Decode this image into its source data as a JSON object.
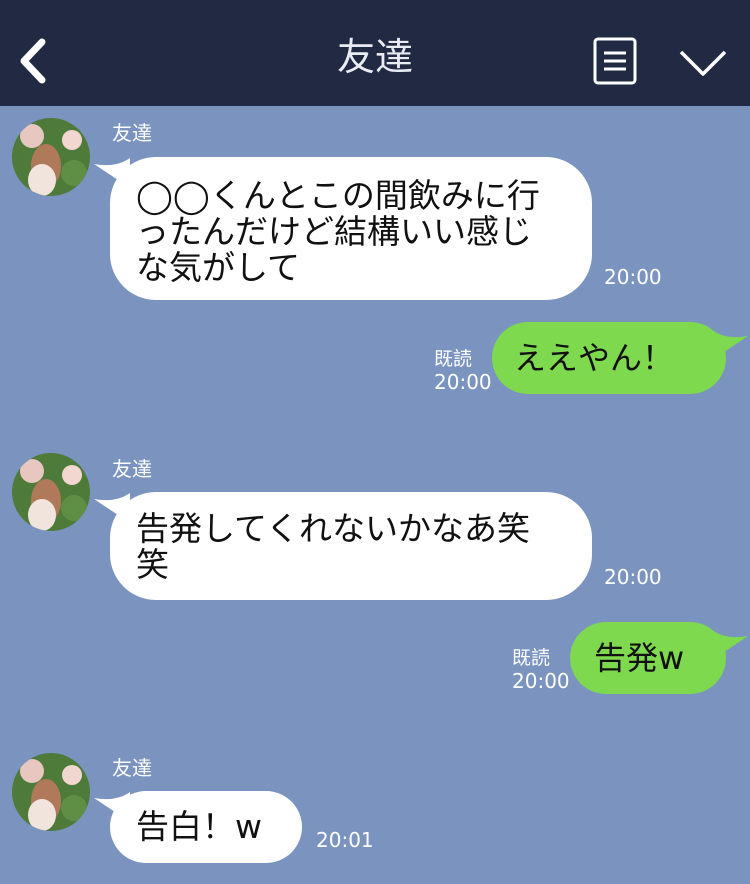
{
  "header": {
    "title": "友達",
    "back_icon": "chevron-left-icon",
    "menu_icon": "menu-list-icon",
    "collapse_icon": "chevron-down-icon"
  },
  "colors": {
    "header_bg": "#222a43",
    "chat_bg": "#7a94bf",
    "incoming_bubble": "#ffffff",
    "outgoing_bubble": "#7fd94e"
  },
  "messages": [
    {
      "direction": "in",
      "sender": "友達",
      "text": "◯◯くんとこの間飲みに行\nったんだけど結構いい感じ\nな気がして",
      "time": "20:00"
    },
    {
      "direction": "out",
      "read": "既読",
      "text": "ええやん！",
      "time": "20:00"
    },
    {
      "direction": "in",
      "sender": "友達",
      "text": "告発してくれないかなあ笑\n笑",
      "time": "20:00"
    },
    {
      "direction": "out",
      "read": "既読",
      "text": "告発w",
      "time": "20:00"
    },
    {
      "direction": "in",
      "sender": "友達",
      "text": "告白！w",
      "time": "20:01"
    }
  ]
}
